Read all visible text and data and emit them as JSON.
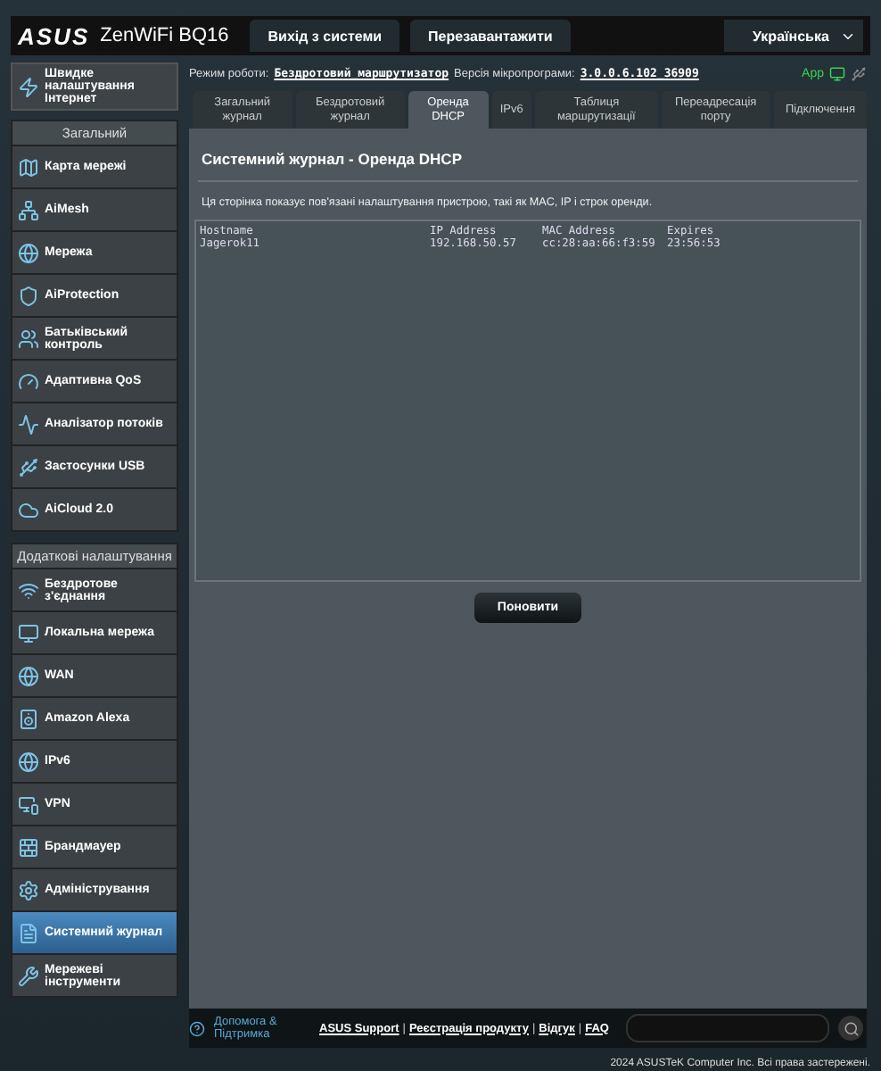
{
  "header": {
    "logo": "ASUS",
    "model": "ZenWiFi BQ16",
    "buttons": [
      "Вихід з системи",
      "Перезавантажити"
    ],
    "language": "Українська"
  },
  "quick_setup": "Швидке налаштування Інтернет",
  "sidebar": {
    "sections": [
      {
        "title": "Загальний",
        "items": [
          {
            "label": "Карта мережі",
            "selected": false
          },
          {
            "label": "AiMesh",
            "selected": false
          },
          {
            "label": "Мережа",
            "selected": false
          },
          {
            "label": "AiProtection",
            "selected": false
          },
          {
            "label": "Батьківський контроль",
            "selected": false
          },
          {
            "label": "Адаптивна QoS",
            "selected": false
          },
          {
            "label": "Аналізатор потоків",
            "selected": false
          },
          {
            "label": "Застосунки USB",
            "selected": false
          },
          {
            "label": "AiCloud 2.0",
            "selected": false
          }
        ]
      },
      {
        "title": "Додаткові налаштування",
        "items": [
          {
            "label": "Бездротове з'єднання",
            "selected": false
          },
          {
            "label": "Локальна мережа",
            "selected": false
          },
          {
            "label": "WAN",
            "selected": false
          },
          {
            "label": "Amazon Alexa",
            "selected": false
          },
          {
            "label": "IPv6",
            "selected": false
          },
          {
            "label": "VPN",
            "selected": false
          },
          {
            "label": "Брандмауер",
            "selected": false
          },
          {
            "label": "Адміністрування",
            "selected": false
          },
          {
            "label": "Системний журнал",
            "selected": true
          },
          {
            "label": "Мережеві інструменти",
            "selected": false
          }
        ]
      }
    ]
  },
  "status": {
    "mode_label": "Режим роботи:",
    "mode": "Бездротовий_маршрутизатор",
    "firmware_label": "Версія мікропрограми:",
    "firmware": "3.0.0.6.102_36909",
    "app": "App"
  },
  "tabs": [
    {
      "label": "Загальний журнал",
      "selected": false
    },
    {
      "label": "Бездротовий журнал",
      "selected": false
    },
    {
      "label": "Оренда DHCP",
      "selected": true
    },
    {
      "label": "IPv6",
      "selected": false
    },
    {
      "label": "Таблиця маршрутизації",
      "selected": false
    },
    {
      "label": "Переадресація порту",
      "selected": false
    },
    {
      "label": "Підключення",
      "selected": false
    }
  ],
  "panel": {
    "title": "Системний журнал - Оренда DHCP",
    "description": "Ця сторінка показує пов'язані налаштування пристрою, такі як MAC, IP і строк оренди.",
    "table": {
      "columns": [
        "Hostname",
        "IP Address",
        "MAC Address",
        "Expires"
      ],
      "rows": [
        [
          "Jagerok11",
          "192.168.50.57",
          "cc:28:aa:66:f3:59",
          "23:56:53"
        ]
      ]
    },
    "button": "Поновити"
  },
  "footer": {
    "help": "Допомога & Підтримка",
    "separator": "|",
    "links": [
      "ASUS Support",
      "Реєстрація продукту",
      "Відгук",
      "FAQ"
    ],
    "copyright": "2024 ASUSTeK Computer Inc. Всі права застережені."
  }
}
